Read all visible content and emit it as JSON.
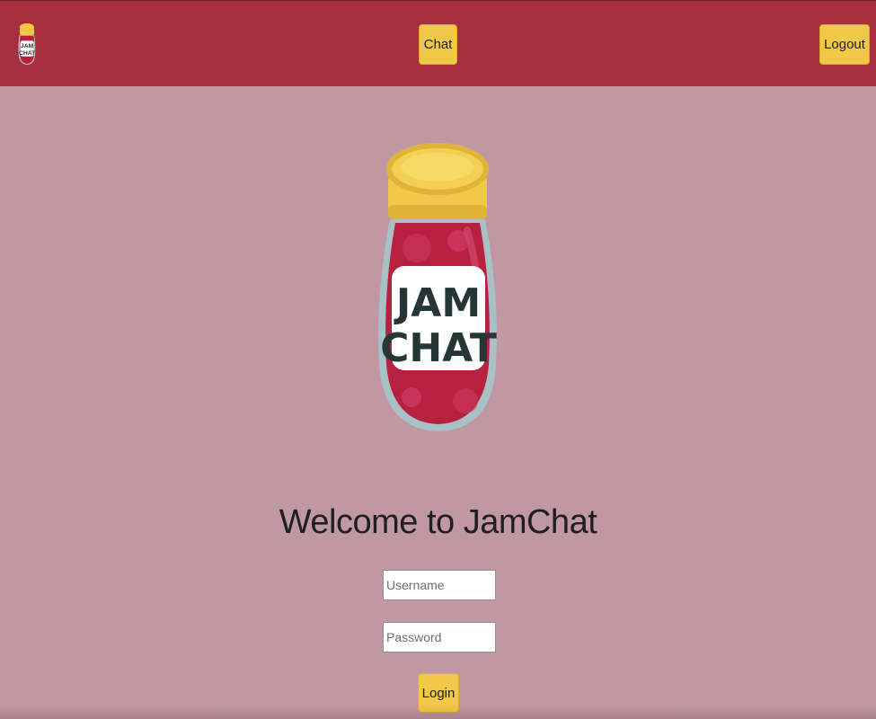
{
  "navbar": {
    "logo_text": [
      "JAM",
      "CHAT"
    ],
    "chat_label": "Chat",
    "logout_label": "Logout"
  },
  "hero": {
    "logo_text": [
      "JAM",
      "CHAT"
    ]
  },
  "login": {
    "title": "Welcome to JamChat",
    "username_placeholder": "Username",
    "password_placeholder": "Password",
    "login_label": "Login"
  },
  "colors": {
    "navbar": "#a62f3e",
    "background": "#c098a4",
    "button": "#f1c847",
    "jam": "#b8203f",
    "lid": "#f1c847"
  },
  "icons": [
    "jam-jar-logo-icon"
  ]
}
